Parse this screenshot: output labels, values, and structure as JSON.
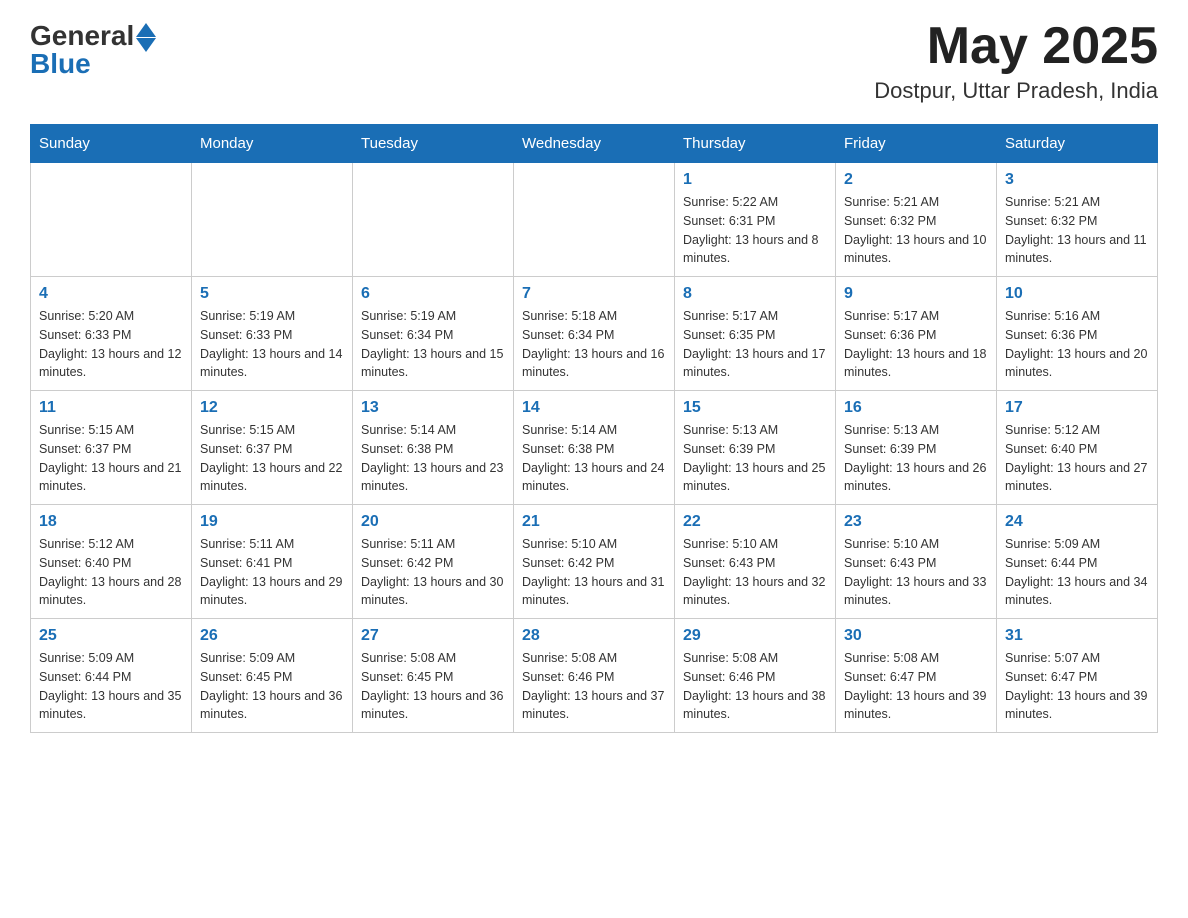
{
  "header": {
    "logo_general": "General",
    "logo_blue": "Blue",
    "month_year": "May 2025",
    "location": "Dostpur, Uttar Pradesh, India"
  },
  "days_of_week": [
    "Sunday",
    "Monday",
    "Tuesday",
    "Wednesday",
    "Thursday",
    "Friday",
    "Saturday"
  ],
  "weeks": [
    [
      {
        "day": "",
        "sunrise": "",
        "sunset": "",
        "daylight": ""
      },
      {
        "day": "",
        "sunrise": "",
        "sunset": "",
        "daylight": ""
      },
      {
        "day": "",
        "sunrise": "",
        "sunset": "",
        "daylight": ""
      },
      {
        "day": "",
        "sunrise": "",
        "sunset": "",
        "daylight": ""
      },
      {
        "day": "1",
        "sunrise": "Sunrise: 5:22 AM",
        "sunset": "Sunset: 6:31 PM",
        "daylight": "Daylight: 13 hours and 8 minutes."
      },
      {
        "day": "2",
        "sunrise": "Sunrise: 5:21 AM",
        "sunset": "Sunset: 6:32 PM",
        "daylight": "Daylight: 13 hours and 10 minutes."
      },
      {
        "day": "3",
        "sunrise": "Sunrise: 5:21 AM",
        "sunset": "Sunset: 6:32 PM",
        "daylight": "Daylight: 13 hours and 11 minutes."
      }
    ],
    [
      {
        "day": "4",
        "sunrise": "Sunrise: 5:20 AM",
        "sunset": "Sunset: 6:33 PM",
        "daylight": "Daylight: 13 hours and 12 minutes."
      },
      {
        "day": "5",
        "sunrise": "Sunrise: 5:19 AM",
        "sunset": "Sunset: 6:33 PM",
        "daylight": "Daylight: 13 hours and 14 minutes."
      },
      {
        "day": "6",
        "sunrise": "Sunrise: 5:19 AM",
        "sunset": "Sunset: 6:34 PM",
        "daylight": "Daylight: 13 hours and 15 minutes."
      },
      {
        "day": "7",
        "sunrise": "Sunrise: 5:18 AM",
        "sunset": "Sunset: 6:34 PM",
        "daylight": "Daylight: 13 hours and 16 minutes."
      },
      {
        "day": "8",
        "sunrise": "Sunrise: 5:17 AM",
        "sunset": "Sunset: 6:35 PM",
        "daylight": "Daylight: 13 hours and 17 minutes."
      },
      {
        "day": "9",
        "sunrise": "Sunrise: 5:17 AM",
        "sunset": "Sunset: 6:36 PM",
        "daylight": "Daylight: 13 hours and 18 minutes."
      },
      {
        "day": "10",
        "sunrise": "Sunrise: 5:16 AM",
        "sunset": "Sunset: 6:36 PM",
        "daylight": "Daylight: 13 hours and 20 minutes."
      }
    ],
    [
      {
        "day": "11",
        "sunrise": "Sunrise: 5:15 AM",
        "sunset": "Sunset: 6:37 PM",
        "daylight": "Daylight: 13 hours and 21 minutes."
      },
      {
        "day": "12",
        "sunrise": "Sunrise: 5:15 AM",
        "sunset": "Sunset: 6:37 PM",
        "daylight": "Daylight: 13 hours and 22 minutes."
      },
      {
        "day": "13",
        "sunrise": "Sunrise: 5:14 AM",
        "sunset": "Sunset: 6:38 PM",
        "daylight": "Daylight: 13 hours and 23 minutes."
      },
      {
        "day": "14",
        "sunrise": "Sunrise: 5:14 AM",
        "sunset": "Sunset: 6:38 PM",
        "daylight": "Daylight: 13 hours and 24 minutes."
      },
      {
        "day": "15",
        "sunrise": "Sunrise: 5:13 AM",
        "sunset": "Sunset: 6:39 PM",
        "daylight": "Daylight: 13 hours and 25 minutes."
      },
      {
        "day": "16",
        "sunrise": "Sunrise: 5:13 AM",
        "sunset": "Sunset: 6:39 PM",
        "daylight": "Daylight: 13 hours and 26 minutes."
      },
      {
        "day": "17",
        "sunrise": "Sunrise: 5:12 AM",
        "sunset": "Sunset: 6:40 PM",
        "daylight": "Daylight: 13 hours and 27 minutes."
      }
    ],
    [
      {
        "day": "18",
        "sunrise": "Sunrise: 5:12 AM",
        "sunset": "Sunset: 6:40 PM",
        "daylight": "Daylight: 13 hours and 28 minutes."
      },
      {
        "day": "19",
        "sunrise": "Sunrise: 5:11 AM",
        "sunset": "Sunset: 6:41 PM",
        "daylight": "Daylight: 13 hours and 29 minutes."
      },
      {
        "day": "20",
        "sunrise": "Sunrise: 5:11 AM",
        "sunset": "Sunset: 6:42 PM",
        "daylight": "Daylight: 13 hours and 30 minutes."
      },
      {
        "day": "21",
        "sunrise": "Sunrise: 5:10 AM",
        "sunset": "Sunset: 6:42 PM",
        "daylight": "Daylight: 13 hours and 31 minutes."
      },
      {
        "day": "22",
        "sunrise": "Sunrise: 5:10 AM",
        "sunset": "Sunset: 6:43 PM",
        "daylight": "Daylight: 13 hours and 32 minutes."
      },
      {
        "day": "23",
        "sunrise": "Sunrise: 5:10 AM",
        "sunset": "Sunset: 6:43 PM",
        "daylight": "Daylight: 13 hours and 33 minutes."
      },
      {
        "day": "24",
        "sunrise": "Sunrise: 5:09 AM",
        "sunset": "Sunset: 6:44 PM",
        "daylight": "Daylight: 13 hours and 34 minutes."
      }
    ],
    [
      {
        "day": "25",
        "sunrise": "Sunrise: 5:09 AM",
        "sunset": "Sunset: 6:44 PM",
        "daylight": "Daylight: 13 hours and 35 minutes."
      },
      {
        "day": "26",
        "sunrise": "Sunrise: 5:09 AM",
        "sunset": "Sunset: 6:45 PM",
        "daylight": "Daylight: 13 hours and 36 minutes."
      },
      {
        "day": "27",
        "sunrise": "Sunrise: 5:08 AM",
        "sunset": "Sunset: 6:45 PM",
        "daylight": "Daylight: 13 hours and 36 minutes."
      },
      {
        "day": "28",
        "sunrise": "Sunrise: 5:08 AM",
        "sunset": "Sunset: 6:46 PM",
        "daylight": "Daylight: 13 hours and 37 minutes."
      },
      {
        "day": "29",
        "sunrise": "Sunrise: 5:08 AM",
        "sunset": "Sunset: 6:46 PM",
        "daylight": "Daylight: 13 hours and 38 minutes."
      },
      {
        "day": "30",
        "sunrise": "Sunrise: 5:08 AM",
        "sunset": "Sunset: 6:47 PM",
        "daylight": "Daylight: 13 hours and 39 minutes."
      },
      {
        "day": "31",
        "sunrise": "Sunrise: 5:07 AM",
        "sunset": "Sunset: 6:47 PM",
        "daylight": "Daylight: 13 hours and 39 minutes."
      }
    ]
  ]
}
